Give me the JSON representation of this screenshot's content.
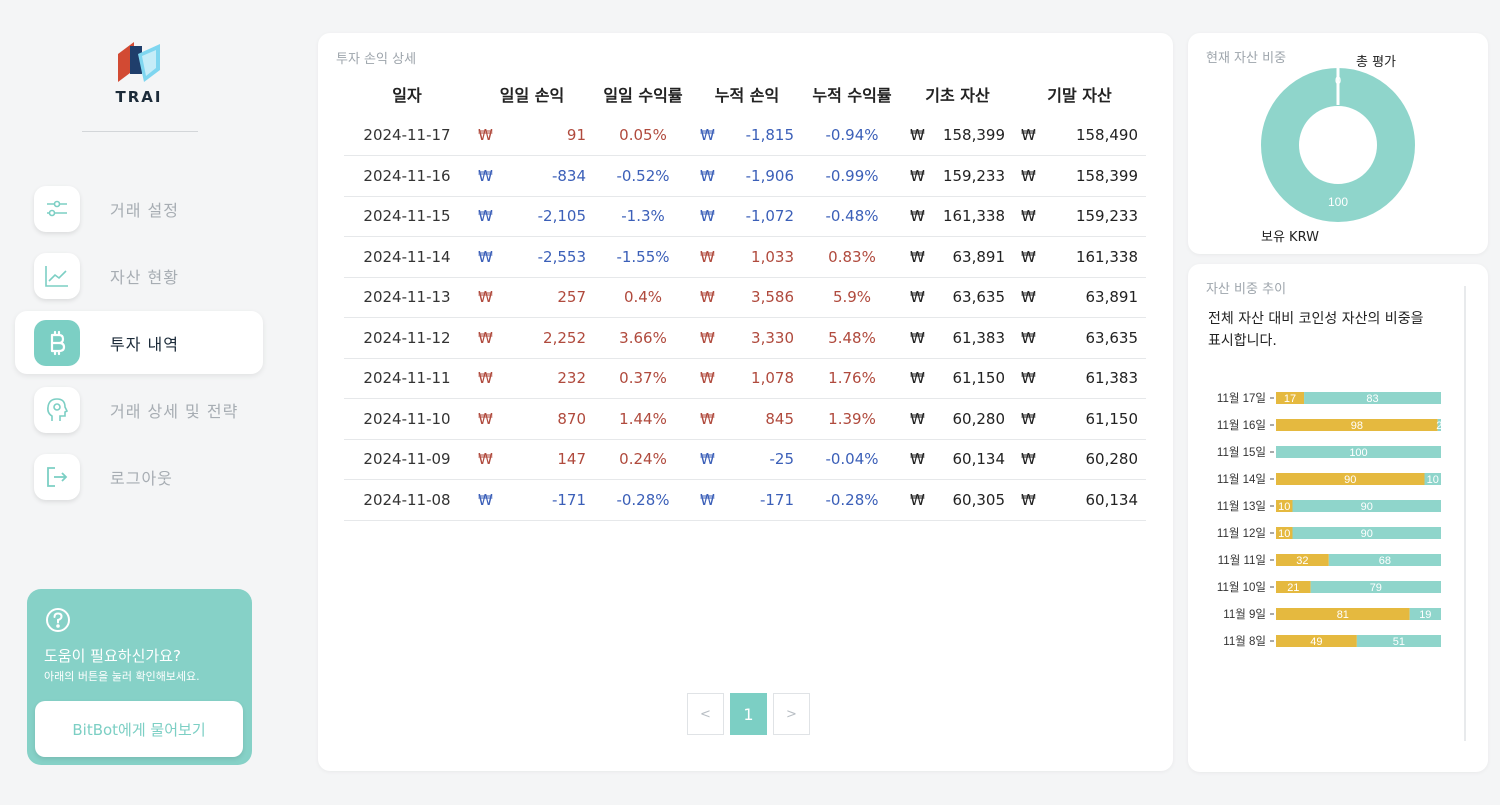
{
  "app": {
    "logo_text": "TRAI"
  },
  "sidebar": {
    "items": [
      {
        "label": "거래 설정",
        "icon": "sliders-icon"
      },
      {
        "label": "자산 현황",
        "icon": "chart-line-icon"
      },
      {
        "label": "투자 내역",
        "icon": "bitcoin-icon",
        "active": true
      },
      {
        "label": "거래 상세 및 전략",
        "icon": "brain-head-icon"
      },
      {
        "label": "로그아웃",
        "icon": "logout-icon"
      }
    ],
    "help": {
      "title": "도움이 필요하신가요?",
      "subtitle": "아래의 버튼을 눌러 확인해보세요.",
      "button": "BitBot에게 물어보기"
    }
  },
  "pnl": {
    "title": "투자 손익 상세",
    "currency": "₩",
    "columns": [
      "일자",
      "일일 손익",
      "일일 수익률",
      "누적 손익",
      "누적 수익률",
      "기초 자산",
      "기말 자산"
    ],
    "rows": [
      {
        "date": "2024-11-17",
        "daily": "91",
        "daily_pct": "0.05%",
        "cum": "-1,815",
        "cum_pct": "-0.94%",
        "begin": "158,399",
        "end": "158,490",
        "daily_sign": "pos",
        "cum_sign": "neg"
      },
      {
        "date": "2024-11-16",
        "daily": "-834",
        "daily_pct": "-0.52%",
        "cum": "-1,906",
        "cum_pct": "-0.99%",
        "begin": "159,233",
        "end": "158,399",
        "daily_sign": "neg",
        "cum_sign": "neg"
      },
      {
        "date": "2024-11-15",
        "daily": "-2,105",
        "daily_pct": "-1.3%",
        "cum": "-1,072",
        "cum_pct": "-0.48%",
        "begin": "161,338",
        "end": "159,233",
        "daily_sign": "neg",
        "cum_sign": "neg"
      },
      {
        "date": "2024-11-14",
        "daily": "-2,553",
        "daily_pct": "-1.55%",
        "cum": "1,033",
        "cum_pct": "0.83%",
        "begin": "63,891",
        "end": "161,338",
        "daily_sign": "neg",
        "cum_sign": "pos"
      },
      {
        "date": "2024-11-13",
        "daily": "257",
        "daily_pct": "0.4%",
        "cum": "3,586",
        "cum_pct": "5.9%",
        "begin": "63,635",
        "end": "63,891",
        "daily_sign": "pos",
        "cum_sign": "pos"
      },
      {
        "date": "2024-11-12",
        "daily": "2,252",
        "daily_pct": "3.66%",
        "cum": "3,330",
        "cum_pct": "5.48%",
        "begin": "61,383",
        "end": "63,635",
        "daily_sign": "pos",
        "cum_sign": "pos"
      },
      {
        "date": "2024-11-11",
        "daily": "232",
        "daily_pct": "0.37%",
        "cum": "1,078",
        "cum_pct": "1.76%",
        "begin": "61,150",
        "end": "61,383",
        "daily_sign": "pos",
        "cum_sign": "pos"
      },
      {
        "date": "2024-11-10",
        "daily": "870",
        "daily_pct": "1.44%",
        "cum": "845",
        "cum_pct": "1.39%",
        "begin": "60,280",
        "end": "61,150",
        "daily_sign": "pos",
        "cum_sign": "pos"
      },
      {
        "date": "2024-11-09",
        "daily": "147",
        "daily_pct": "0.24%",
        "cum": "-25",
        "cum_pct": "-0.04%",
        "begin": "60,134",
        "end": "60,280",
        "daily_sign": "pos",
        "cum_sign": "neg"
      },
      {
        "date": "2024-11-08",
        "daily": "-171",
        "daily_pct": "-0.28%",
        "cum": "-171",
        "cum_pct": "-0.28%",
        "begin": "60,305",
        "end": "60,134",
        "daily_sign": "neg",
        "cum_sign": "neg"
      }
    ],
    "pagination": {
      "prev": "<",
      "current": "1",
      "next": ">"
    }
  },
  "colors": {
    "accent": "#7ccfc4",
    "coin": "#e5b93f",
    "krw": "#8fd5cb",
    "positive": "#b04a3d",
    "negative": "#3b5fb8"
  },
  "chart_data": [
    {
      "type": "pie",
      "title": "현재 자산 비중",
      "slices": [
        {
          "name": "총 평가",
          "value": 0,
          "label": "0"
        },
        {
          "name": "보유 KRW",
          "value": 100,
          "label": "100"
        }
      ]
    },
    {
      "type": "bar",
      "stacked": true,
      "orientation": "horizontal",
      "title": "자산 비중 추이",
      "description": "전체 자산 대비 코인성 자산의 비중을\n표시합니다.",
      "categories": [
        "11월 17일",
        "11월 16일",
        "11월 15일",
        "11월 14일",
        "11월 13일",
        "11월 12일",
        "11월 11일",
        "11월 10일",
        "11월 9일",
        "11월 8일"
      ],
      "series": [
        {
          "values": [
            17,
            98,
            0,
            90,
            10,
            10,
            32,
            21,
            81,
            49
          ]
        },
        {
          "values": [
            83,
            2,
            100,
            10,
            90,
            90,
            68,
            79,
            19,
            51
          ]
        }
      ]
    }
  ]
}
